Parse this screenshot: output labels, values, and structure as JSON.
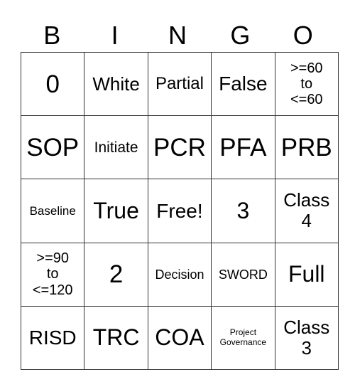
{
  "header": [
    "B",
    "I",
    "N",
    "G",
    "O"
  ],
  "rows": [
    [
      {
        "text": "0",
        "size": "s36"
      },
      {
        "text": "White",
        "size": "s26"
      },
      {
        "text": "Partial",
        "size": "s24"
      },
      {
        "text": "False",
        "size": "s28"
      },
      {
        "text": ">=60\nto\n<=60",
        "size": "s20"
      }
    ],
    [
      {
        "text": "SOP",
        "size": "s36"
      },
      {
        "text": "Initiate",
        "size": "s22"
      },
      {
        "text": "PCR",
        "size": "s36"
      },
      {
        "text": "PFA",
        "size": "s36"
      },
      {
        "text": "PRB",
        "size": "s36"
      }
    ],
    [
      {
        "text": "Baseline",
        "size": "s17"
      },
      {
        "text": "True",
        "size": "s32"
      },
      {
        "text": "Free!",
        "size": "s28"
      },
      {
        "text": "3",
        "size": "s32"
      },
      {
        "text": "Class\n4",
        "size": "s26"
      }
    ],
    [
      {
        "text": ">=90\nto\n<=120",
        "size": "s20"
      },
      {
        "text": "2",
        "size": "s36"
      },
      {
        "text": "Decision",
        "size": "s18"
      },
      {
        "text": "SWORD",
        "size": "s18"
      },
      {
        "text": "Full",
        "size": "s32"
      }
    ],
    [
      {
        "text": "RISD",
        "size": "s28"
      },
      {
        "text": "TRC",
        "size": "s32"
      },
      {
        "text": "COA",
        "size": "s32"
      },
      {
        "text": "Project\nGovernance",
        "size": "s12"
      },
      {
        "text": "Class\n3",
        "size": "s26"
      }
    ]
  ]
}
